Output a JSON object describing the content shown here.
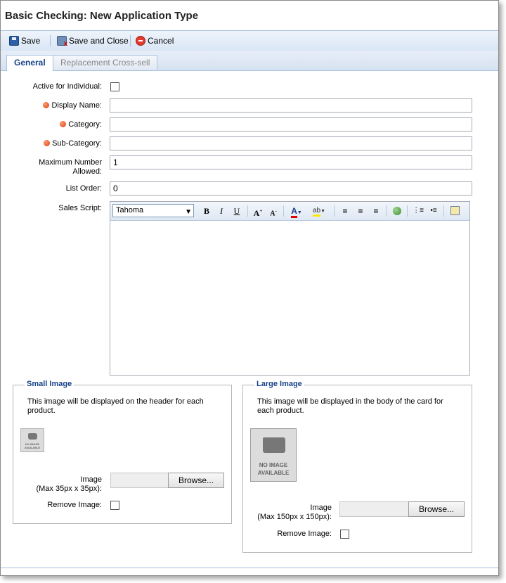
{
  "window": {
    "title": "Basic Checking: New Application Type"
  },
  "toolbar": {
    "save_label": "Save",
    "save_close_label": "Save and Close",
    "cancel_label": "Cancel"
  },
  "tabs": [
    {
      "label": "General",
      "active": true
    },
    {
      "label": "Replacement Cross-sell",
      "active": false
    }
  ],
  "form": {
    "active_label": "Active for Individual:",
    "display_name_label": "Display Name:",
    "display_name_value": "",
    "category_label": "Category:",
    "category_value": "",
    "subcategory_label": "Sub-Category:",
    "subcategory_value": "",
    "max_number_label_line1": "Maximum Number",
    "max_number_label_line2": "Allowed:",
    "max_number_value": "1",
    "list_order_label": "List Order:",
    "list_order_value": "0",
    "sales_script_label": "Sales Script:",
    "editor_font": "Tahoma"
  },
  "small_image": {
    "legend": "Small Image",
    "desc_line1": "This image will be displayed on the header for each",
    "desc_line2": "product.",
    "placeholder_line1": "NO IMAGE",
    "placeholder_line2": "AVAILABLE",
    "image_label_line1": "Image",
    "image_label_line2": "(Max 35px x 35px):",
    "browse_label": "Browse...",
    "remove_label": "Remove Image:"
  },
  "large_image": {
    "legend": "Large Image",
    "desc_line1": "This image will be displayed in the body of the card for",
    "desc_line2": "each product.",
    "placeholder_line1": "NO IMAGE",
    "placeholder_line2": "AVAILABLE",
    "image_label_line1": "Image",
    "image_label_line2": "(Max 150px x 150px):",
    "browse_label": "Browse...",
    "remove_label": "Remove Image:"
  },
  "colors": {
    "required_dot": "#d4401a",
    "legend_text": "#15428b",
    "toolbar_bg": "#d9e6f5"
  }
}
